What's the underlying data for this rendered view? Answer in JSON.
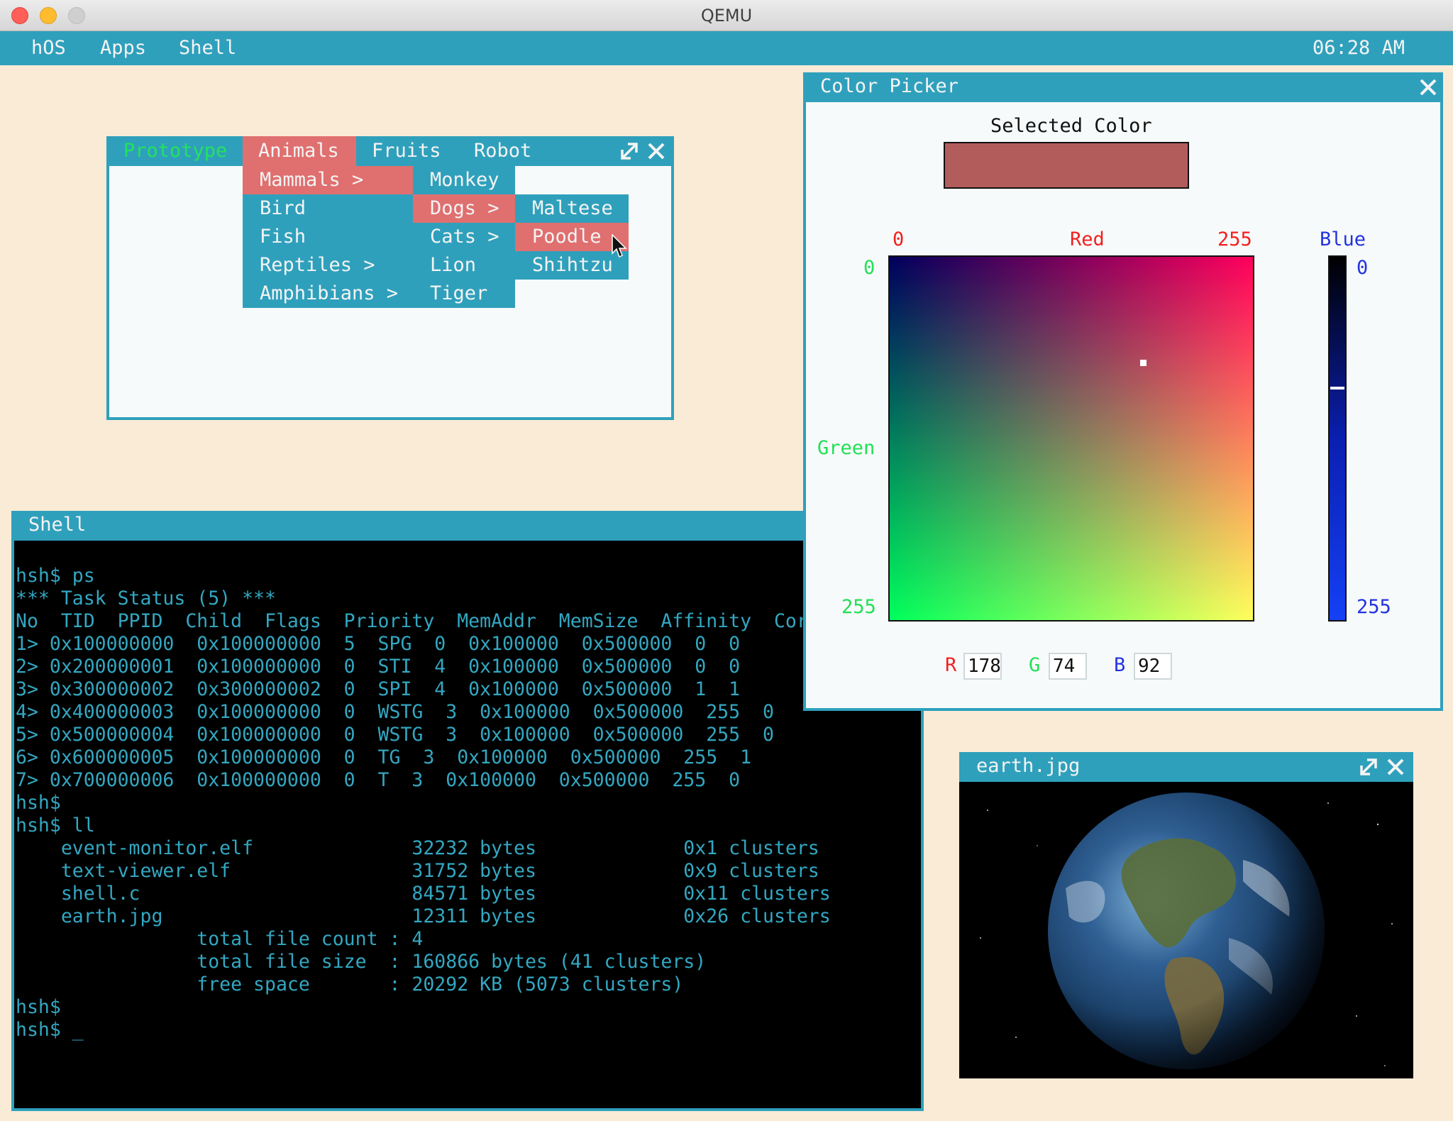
{
  "host": {
    "title": "QEMU"
  },
  "taskbar": {
    "menu": [
      "hOS",
      "Apps",
      "Shell"
    ],
    "clock": "06:28 AM"
  },
  "prototype_window": {
    "menu": [
      "Prototype",
      "Animals",
      "Fruits",
      "Robot"
    ],
    "menu_level1": [
      "Mammals >",
      "Bird",
      "Fish",
      "Reptiles >",
      "Amphibians >"
    ],
    "menu_level2": [
      "Monkey",
      "Dogs >",
      "Cats >",
      "Lion",
      "Tiger"
    ],
    "menu_level3": [
      "Maltese",
      "Poodle",
      "Shihtzu"
    ]
  },
  "color_picker": {
    "title": "Color Picker",
    "selected_label": "Selected Color",
    "selected_color": "#b25c5c",
    "red_label": "Red",
    "green_label": "Green",
    "blue_label": "Blue",
    "red_min": "0",
    "red_max": "255",
    "green_min": "0",
    "green_max": "255",
    "blue_min": "0",
    "blue_max": "255",
    "r_label": "R",
    "g_label": "G",
    "b_label": "B",
    "r_value": "178",
    "g_value": "74",
    "b_value": "92",
    "label_colors": {
      "red": "#f22020",
      "green": "#22e055",
      "blue": "#2233e0"
    }
  },
  "shell_window": {
    "title": "Shell",
    "lines": [
      "",
      "hsh$ ps",
      "*** Task Status (5) ***",
      "No  TID  PPID  Child  Flags  Priority  MemAddr  MemSize  Affinity  Cor",
      "1> 0x100000000  0x100000000  5  SPG  0  0x100000  0x500000  0  0",
      "2> 0x200000001  0x100000000  0  STI  4  0x100000  0x500000  0  0",
      "3> 0x300000002  0x300000002  0  SPI  4  0x100000  0x500000  1  1",
      "4> 0x400000003  0x100000000  0  WSTG  3  0x100000  0x500000  255  0",
      "5> 0x500000004  0x100000000  0  WSTG  3  0x100000  0x500000  255  0",
      "6> 0x600000005  0x100000000  0  TG  3  0x100000  0x500000  255  1",
      "7> 0x700000006  0x100000000  0  T  3  0x100000  0x500000  255  0",
      "hsh$",
      "hsh$ ll",
      "    event-monitor.elf              32232 bytes             0x1 clusters",
      "    text-viewer.elf                31752 bytes             0x9 clusters",
      "    shell.c                        84571 bytes             0x11 clusters",
      "    earth.jpg                      12311 bytes             0x26 clusters",
      "                total file count : 4",
      "                total file size  : 160866 bytes (41 clusters)",
      "                free space       : 20292 KB (5073 clusters)",
      "hsh$",
      "hsh$ _"
    ]
  },
  "earth_window": {
    "title": "earth.jpg"
  }
}
